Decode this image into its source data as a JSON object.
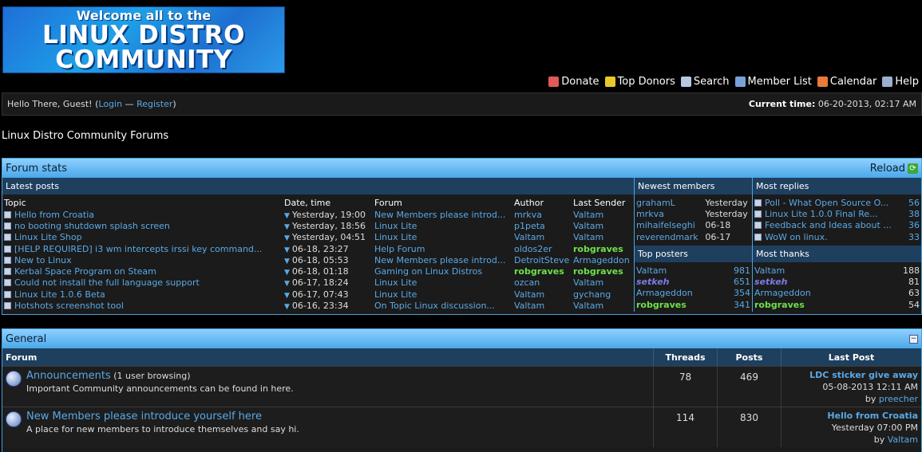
{
  "logo": {
    "line1": "Welcome all to the",
    "line2": "LINUX DISTRO",
    "line3": "COMMUNITY"
  },
  "topmenu": [
    {
      "label": "Donate",
      "icon": "gift-icon",
      "color": "#e05a5a"
    },
    {
      "label": "Top Donors",
      "icon": "trophy-icon",
      "color": "#e8c82a"
    },
    {
      "label": "Search",
      "icon": "search-icon",
      "color": "#b8c8e0"
    },
    {
      "label": "Member List",
      "icon": "members-icon",
      "color": "#7aa0d8"
    },
    {
      "label": "Calendar",
      "icon": "calendar-icon",
      "color": "#e87a3a"
    },
    {
      "label": "Help",
      "icon": "help-icon",
      "color": "#9ab0d0"
    }
  ],
  "welcome": {
    "greeting": "Hello There, Guest! (",
    "login": "Login",
    "sep": " — ",
    "register": "Register",
    "end": ")",
    "time_label": "Current time:",
    "time_value": " 06-20-2013, 02:17 AM"
  },
  "forum_title": "Linux Distro Community Forums",
  "stats": {
    "title": "Forum stats",
    "reload": "Reload",
    "latest_title": "Latest posts",
    "headers": {
      "topic": "Topic",
      "date": "Date, time",
      "forum": "Forum",
      "author": "Author",
      "last": "Last Sender"
    },
    "posts": [
      {
        "topic": "Hello from Croatia",
        "date": "Yesterday, 19:00",
        "forum": "New Members please introd...",
        "author": "mrkva",
        "author_style": "",
        "last": "Valtam",
        "last_style": ""
      },
      {
        "topic": "no booting shutdown splash screen",
        "date": "Yesterday, 18:56",
        "forum": "Linux Lite",
        "author": "p1peta",
        "author_style": "",
        "last": "Valtam",
        "last_style": ""
      },
      {
        "topic": "Linux Lite Shop",
        "date": "Yesterday, 04:51",
        "forum": "Linux Lite",
        "author": "Valtam",
        "author_style": "",
        "last": "Valtam",
        "last_style": ""
      },
      {
        "topic": "[HELP REQUIRED]  i3 wm intercepts irssi key command...",
        "date": "06-18, 23:27",
        "forum": "Help Forum",
        "author": "oldos2er",
        "author_style": "",
        "last": "robgraves",
        "last_style": "green"
      },
      {
        "topic": "New to Linux",
        "date": "06-18, 05:53",
        "forum": "New Members please introd...",
        "author": "DetroitSteve",
        "author_style": "",
        "last": "Armageddon",
        "last_style": ""
      },
      {
        "topic": "Kerbal Space Program on Steam",
        "date": "06-18, 01:18",
        "forum": "Gaming on Linux Distros",
        "author": "robgraves",
        "author_style": "green",
        "last": "robgraves",
        "last_style": "green"
      },
      {
        "topic": "Could not install the full language support",
        "date": "06-17, 18:24",
        "forum": "Linux Lite",
        "author": "ozcan",
        "author_style": "",
        "last": "Valtam",
        "last_style": ""
      },
      {
        "topic": "Linux Lite 1.0.6 Beta",
        "date": "06-17, 07:43",
        "forum": "Linux Lite",
        "author": "Valtam",
        "author_style": "",
        "last": "gychang",
        "last_style": ""
      },
      {
        "topic": "Hotshots screenshot tool",
        "date": "06-16, 23:34",
        "forum": "On Topic Linux discussion...",
        "author": "Valtam",
        "author_style": "",
        "last": "Valtam",
        "last_style": ""
      }
    ],
    "newest_title": "Newest members",
    "newest": [
      {
        "name": "grahamL",
        "when": "Yesterday"
      },
      {
        "name": "mrkva",
        "when": "Yesterday"
      },
      {
        "name": "mihaifelseghi",
        "when": "06-18"
      },
      {
        "name": "reverendmark",
        "when": "06-17"
      }
    ],
    "posters_title": "Top posters",
    "posters": [
      {
        "name": "Valtam",
        "count": "981",
        "style": ""
      },
      {
        "name": "setkeh",
        "count": "651",
        "style": "purple"
      },
      {
        "name": "Armageddon",
        "count": "354",
        "style": ""
      },
      {
        "name": "robgraves",
        "count": "341",
        "style": "green"
      }
    ],
    "replies_title": "Most replies",
    "replies": [
      {
        "topic": "Poll - What Open Source O...",
        "count": "56"
      },
      {
        "topic": "Linux Lite 1.0.0 Final Re...",
        "count": "38"
      },
      {
        "topic": "Feedback and Ideas about ...",
        "count": "36"
      },
      {
        "topic": "WoW on linux.",
        "count": "33"
      }
    ],
    "thanks_title": "Most thanks",
    "thanks": [
      {
        "name": "Valtam",
        "count": "188",
        "style": ""
      },
      {
        "name": "setkeh",
        "count": "81",
        "style": "purple"
      },
      {
        "name": "Armageddon",
        "count": "63",
        "style": ""
      },
      {
        "name": "robgraves",
        "count": "54",
        "style": "green"
      }
    ]
  },
  "general": {
    "title": "General",
    "collapse": "−",
    "headers": {
      "forum": "Forum",
      "threads": "Threads",
      "posts": "Posts",
      "last": "Last Post"
    },
    "forums": [
      {
        "name": "Announcements",
        "browsing": " (1 user browsing)",
        "desc": "Important Community announcements can be found in here.",
        "threads": "78",
        "posts": "469",
        "last_title": "LDC sticker give away",
        "last_date": "05-08-2013 12:11 AM",
        "by": "by ",
        "last_user": "preecher"
      },
      {
        "name": "New Members please introduce yourself here",
        "browsing": "",
        "desc": "A place for new members to introduce themselves and say hi.",
        "threads": "114",
        "posts": "830",
        "last_title": "Hello from Croatia",
        "last_date": "Yesterday 07:00 PM",
        "by": "by ",
        "last_user": "Valtam"
      }
    ]
  }
}
